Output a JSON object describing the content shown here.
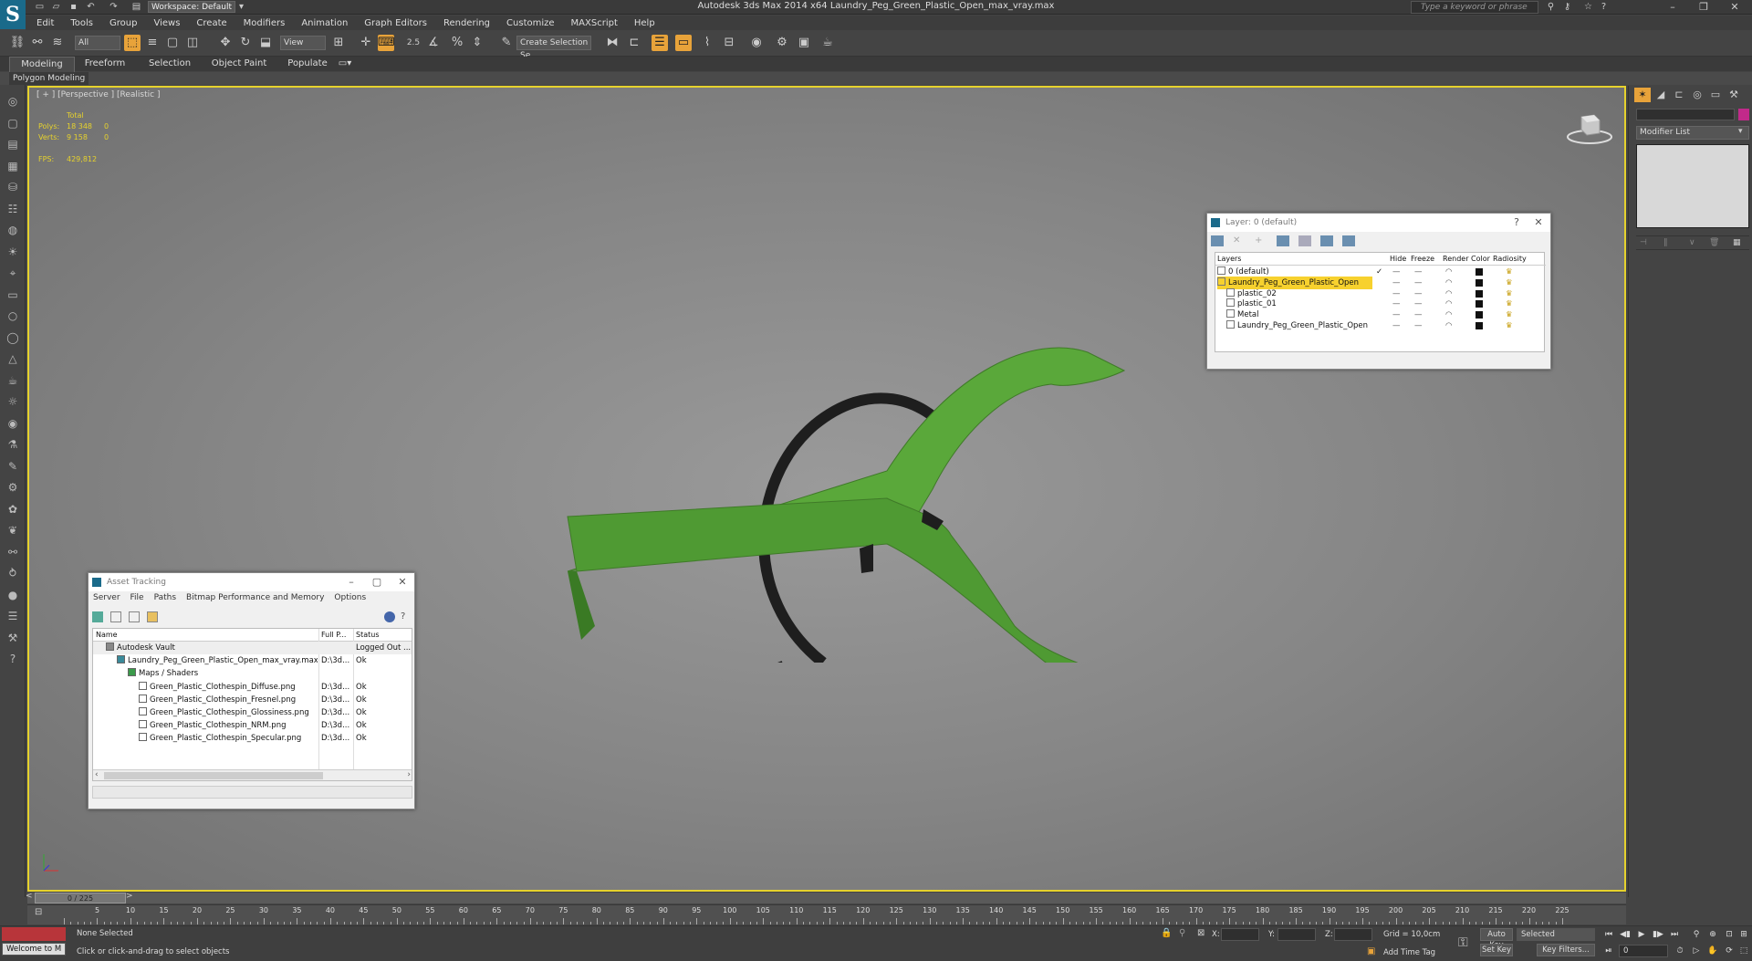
{
  "app": {
    "title": "Autodesk 3ds Max  2014 x64    Laundry_Peg_Green_Plastic_Open_max_vray.max",
    "workspace": "Workspace: Default",
    "search_placeholder": "Type a keyword or phrase"
  },
  "menu": [
    "Edit",
    "Tools",
    "Group",
    "Views",
    "Create",
    "Modifiers",
    "Animation",
    "Graph Editors",
    "Rendering",
    "Customize",
    "MAXScript",
    "Help"
  ],
  "toolbar": {
    "filter": "All",
    "refcoord": "View",
    "snap_label": "2.5",
    "named_selection": "Create Selection Se"
  },
  "ribbon": {
    "tabs": [
      "Modeling",
      "Freeform",
      "Selection",
      "Object Paint",
      "Populate"
    ],
    "sub": "Polygon Modeling"
  },
  "viewport": {
    "label": "[ + ] [Perspective ] [Realistic ]",
    "stats": {
      "header": "Total",
      "polys_label": "Polys:",
      "polys_total": "18 348",
      "polys_sel": "0",
      "verts_label": "Verts:",
      "verts_total": "9 158",
      "verts_sel": "0",
      "fps_label": "FPS:",
      "fps": "429,812"
    }
  },
  "layer_dialog": {
    "title": "Layer: 0 (default)",
    "columns": [
      "Layers",
      "Hide",
      "Freeze",
      "Render",
      "Color",
      "Radiosity"
    ],
    "rows": [
      {
        "name": "0 (default)",
        "indent": 0,
        "check": true,
        "color": "#111111"
      },
      {
        "name": "Laundry_Peg_Green_Plastic_Open",
        "indent": 0,
        "check": false,
        "color": "#111111",
        "highlight": true
      },
      {
        "name": "plastic_02",
        "indent": 1,
        "check": false,
        "color": "#111111"
      },
      {
        "name": "plastic_01",
        "indent": 1,
        "check": false,
        "color": "#111111"
      },
      {
        "name": "Metal",
        "indent": 1,
        "check": false,
        "color": "#111111"
      },
      {
        "name": "Laundry_Peg_Green_Plastic_Open",
        "indent": 1,
        "check": false,
        "color": "#111111"
      }
    ]
  },
  "asset_dialog": {
    "title": "Asset Tracking",
    "menu": [
      "Server",
      "File",
      "Paths",
      "Bitmap Performance and Memory",
      "Options"
    ],
    "columns": [
      "Name",
      "Full P...",
      "Status"
    ],
    "rows": [
      {
        "name": "Autodesk Vault",
        "indent": 1,
        "path": "",
        "status": "Logged Out ..."
      },
      {
        "name": "Laundry_Peg_Green_Plastic_Open_max_vray.max",
        "indent": 2,
        "path": "D:\\3d...",
        "status": "Ok"
      },
      {
        "name": "Maps / Shaders",
        "indent": 3,
        "path": "",
        "status": ""
      },
      {
        "name": "Green_Plastic_Clothespin_Diffuse.png",
        "indent": 4,
        "path": "D:\\3d...",
        "status": "Ok"
      },
      {
        "name": "Green_Plastic_Clothespin_Fresnel.png",
        "indent": 4,
        "path": "D:\\3d...",
        "status": "Ok"
      },
      {
        "name": "Green_Plastic_Clothespin_Glossiness.png",
        "indent": 4,
        "path": "D:\\3d...",
        "status": "Ok"
      },
      {
        "name": "Green_Plastic_Clothespin_NRM.png",
        "indent": 4,
        "path": "D:\\3d...",
        "status": "Ok"
      },
      {
        "name": "Green_Plastic_Clothespin_Specular.png",
        "indent": 4,
        "path": "D:\\3d...",
        "status": "Ok"
      }
    ]
  },
  "command_panel": {
    "modifier_list": "Modifier List"
  },
  "timeline": {
    "position": "0 / 225",
    "frame_total": 225,
    "labels": [
      0,
      5,
      10,
      15,
      20,
      25,
      30,
      35,
      40,
      45,
      50,
      55,
      60,
      65,
      70,
      75,
      80,
      85,
      90,
      95,
      100,
      105,
      110,
      115,
      120,
      125,
      130,
      135,
      140,
      145,
      150,
      155,
      160,
      165,
      170,
      175,
      180,
      185,
      190,
      195,
      200,
      205,
      210,
      215,
      220,
      225
    ]
  },
  "status": {
    "maxscript": "Welcome to M",
    "selection": "None Selected",
    "prompt": "Click or click-and-drag to select objects",
    "x_label": "X:",
    "y_label": "Y:",
    "z_label": "Z:",
    "grid": "Grid = 10,0cm",
    "add_time_tag": "Add Time Tag",
    "auto_key": "Auto Key",
    "set_key": "Set Key",
    "selected": "Selected",
    "key_filters": "Key Filters...",
    "frame": "0"
  },
  "colors": {
    "accent": "#e8a33a",
    "viewport_border": "#e6d22d",
    "peg_green": "#5aa83a",
    "spring_black": "#1e1e1e"
  }
}
